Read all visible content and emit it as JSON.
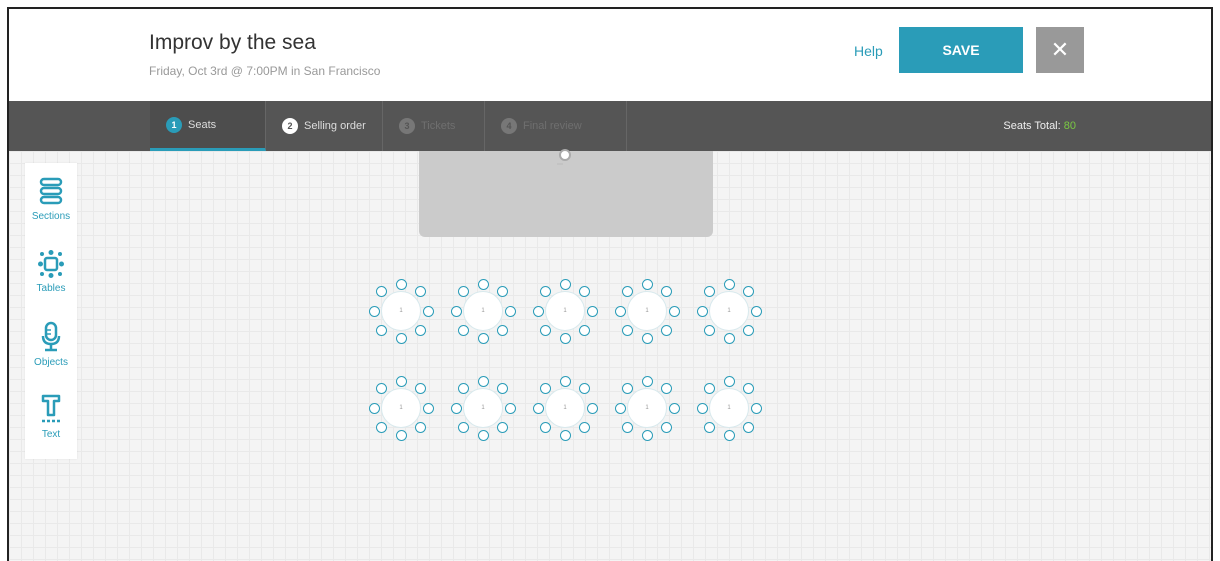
{
  "header": {
    "title": "Improv by the sea",
    "subtitle": "Friday, Oct 3rd @ 7:00PM in San Francisco",
    "help_label": "Help",
    "save_label": "SAVE",
    "close_symbol": "✕"
  },
  "steps": [
    {
      "num": "1",
      "label": "Seats",
      "state": "active"
    },
    {
      "num": "2",
      "label": "Selling order",
      "state": "enabled"
    },
    {
      "num": "3",
      "label": "Tickets",
      "state": "disabled"
    },
    {
      "num": "4",
      "label": "Final review",
      "state": "disabled"
    }
  ],
  "seats_total": {
    "label": "Seats Total:",
    "value": "80"
  },
  "toolbar": {
    "items": [
      {
        "label": "Sections",
        "icon": "sections-icon"
      },
      {
        "label": "Tables",
        "icon": "tables-icon"
      },
      {
        "label": "Objects",
        "icon": "microphone-icon"
      },
      {
        "label": "Text",
        "icon": "text-icon"
      }
    ]
  },
  "tables": {
    "rows": [
      [
        "1",
        "1",
        "1",
        "1",
        "1"
      ],
      [
        "1",
        "1",
        "1",
        "1",
        "1"
      ]
    ],
    "chairs_per_table": 8
  },
  "colors": {
    "accent": "#2a9cb8",
    "nav_bg": "#555555",
    "seats_value": "#7ac943",
    "close_bg": "#999999"
  }
}
